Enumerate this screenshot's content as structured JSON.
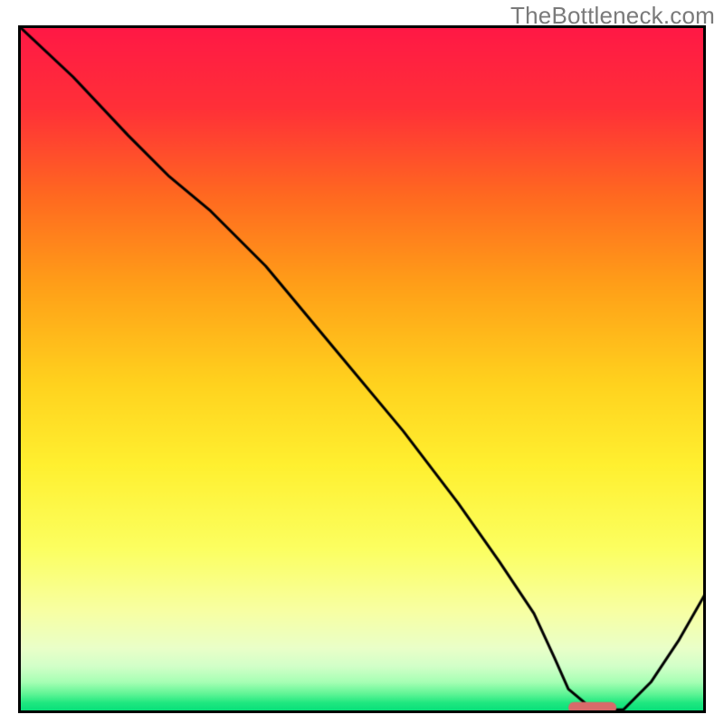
{
  "watermark": "TheBottleneck.com",
  "chart_data": {
    "type": "line",
    "title": "",
    "xlabel": "",
    "ylabel": "",
    "xlim": [
      0,
      100
    ],
    "ylim": [
      0,
      100
    ],
    "grid": false,
    "legend": false,
    "gradient_stops": [
      {
        "t": 0.0,
        "color": "#ff1846"
      },
      {
        "t": 0.12,
        "color": "#ff3038"
      },
      {
        "t": 0.25,
        "color": "#ff6a20"
      },
      {
        "t": 0.38,
        "color": "#ffa018"
      },
      {
        "t": 0.52,
        "color": "#ffd21e"
      },
      {
        "t": 0.64,
        "color": "#fff030"
      },
      {
        "t": 0.76,
        "color": "#fcff60"
      },
      {
        "t": 0.85,
        "color": "#f8ffa2"
      },
      {
        "t": 0.905,
        "color": "#eaffc8"
      },
      {
        "t": 0.932,
        "color": "#d2ffc8"
      },
      {
        "t": 0.955,
        "color": "#a6ffb4"
      },
      {
        "t": 0.972,
        "color": "#60f596"
      },
      {
        "t": 0.985,
        "color": "#20e880"
      },
      {
        "t": 1.0,
        "color": "#00dc78"
      }
    ],
    "series": [
      {
        "name": "bottleneck-curve",
        "stroke": "#000000",
        "stroke_width": 3,
        "x": [
          0.0,
          8.0,
          16.0,
          22.0,
          28.0,
          36.0,
          46.0,
          56.0,
          64.0,
          70.0,
          75.0,
          78.0,
          80.0,
          83.0,
          85.0,
          88.0,
          92.0,
          96.0,
          100.0
        ],
        "y": [
          100.0,
          92.5,
          84.0,
          78.0,
          73.0,
          65.0,
          53.0,
          41.0,
          30.5,
          22.0,
          14.5,
          8.0,
          3.5,
          1.0,
          0.5,
          0.5,
          4.5,
          10.5,
          17.5
        ]
      }
    ],
    "marker": {
      "name": "optimal-range",
      "shape": "rounded-rect",
      "fill": "#d86a6a",
      "x_start": 80.0,
      "x_end": 87.0,
      "y": 0.8,
      "height": 1.6
    }
  }
}
